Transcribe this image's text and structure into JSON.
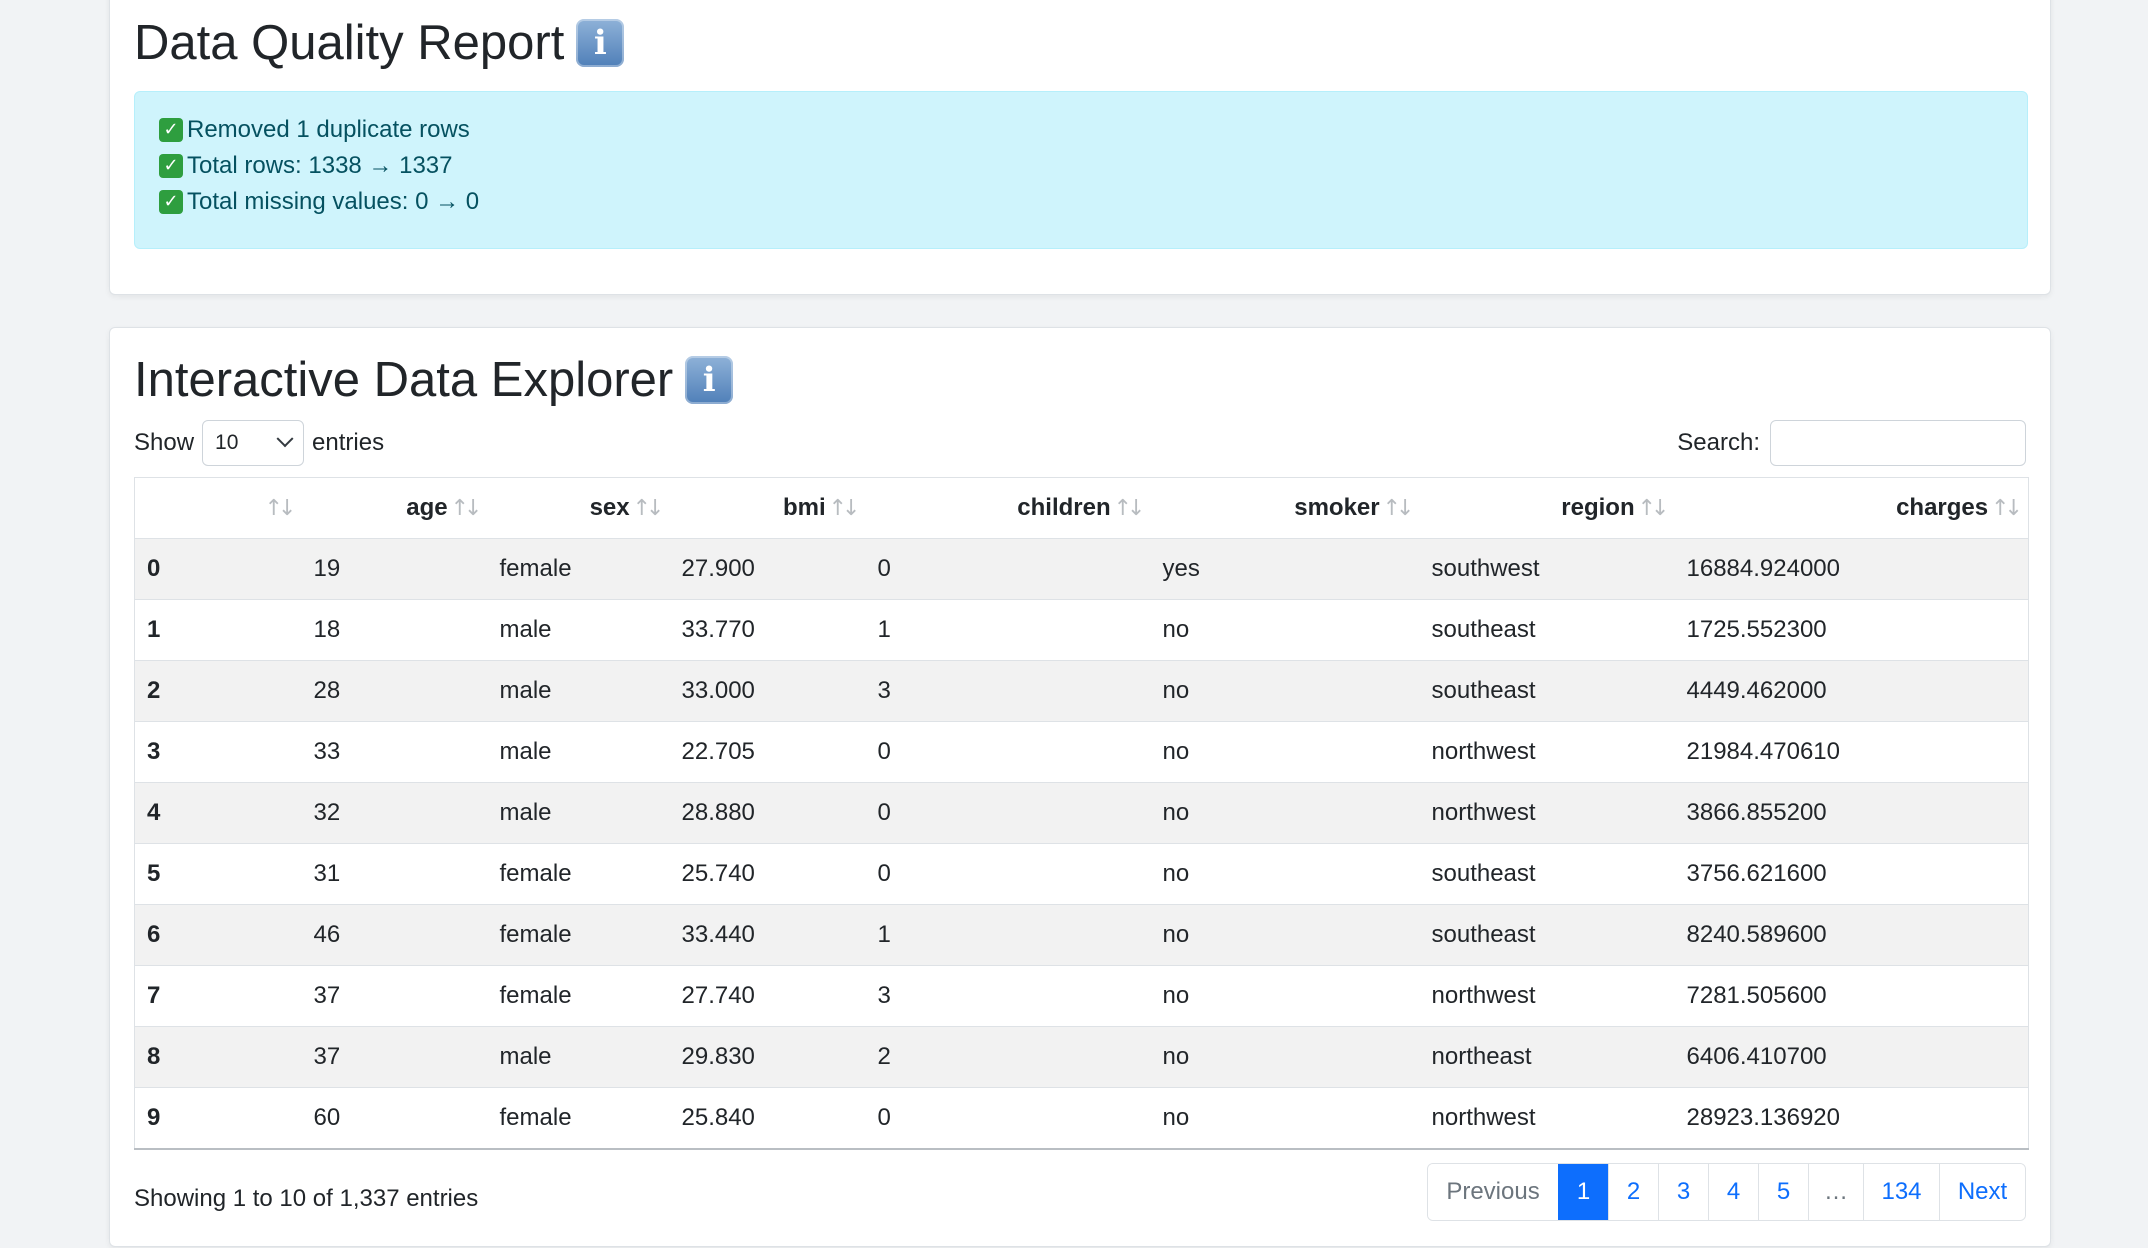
{
  "quality_report": {
    "title": "Data Quality Report",
    "messages": [
      "Removed 1 duplicate rows",
      "Total rows: 1338 → 1337",
      "Total missing values: 0 → 0"
    ]
  },
  "explorer": {
    "title": "Interactive Data Explorer",
    "length": {
      "show_label": "Show",
      "selected": "10",
      "entries_label": "entries"
    },
    "search": {
      "label": "Search:",
      "value": ""
    },
    "columns": [
      "",
      "age",
      "sex",
      "bmi",
      "children",
      "smoker",
      "region",
      "charges"
    ],
    "rows": [
      [
        "0",
        "19",
        "female",
        "27.900",
        "0",
        "yes",
        "southwest",
        "16884.924000"
      ],
      [
        "1",
        "18",
        "male",
        "33.770",
        "1",
        "no",
        "southeast",
        "1725.552300"
      ],
      [
        "2",
        "28",
        "male",
        "33.000",
        "3",
        "no",
        "southeast",
        "4449.462000"
      ],
      [
        "3",
        "33",
        "male",
        "22.705",
        "0",
        "no",
        "northwest",
        "21984.470610"
      ],
      [
        "4",
        "32",
        "male",
        "28.880",
        "0",
        "no",
        "northwest",
        "3866.855200"
      ],
      [
        "5",
        "31",
        "female",
        "25.740",
        "0",
        "no",
        "southeast",
        "3756.621600"
      ],
      [
        "6",
        "46",
        "female",
        "33.440",
        "1",
        "no",
        "southeast",
        "8240.589600"
      ],
      [
        "7",
        "37",
        "female",
        "27.740",
        "3",
        "no",
        "northwest",
        "7281.505600"
      ],
      [
        "8",
        "37",
        "male",
        "29.830",
        "2",
        "no",
        "northeast",
        "6406.410700"
      ],
      [
        "9",
        "60",
        "female",
        "25.840",
        "0",
        "no",
        "northwest",
        "28923.136920"
      ]
    ],
    "info": "Showing 1 to 10 of 1,337 entries",
    "pagination": {
      "previous": "Previous",
      "pages": [
        "1",
        "2",
        "3",
        "4",
        "5"
      ],
      "ellipsis": "…",
      "last": "134",
      "next": "Next",
      "active": "1"
    }
  },
  "colors": {
    "accent": "#0d6efd",
    "alert_bg": "#cff4fc",
    "alert_text": "#055160",
    "stripe": "#f2f2f2"
  }
}
